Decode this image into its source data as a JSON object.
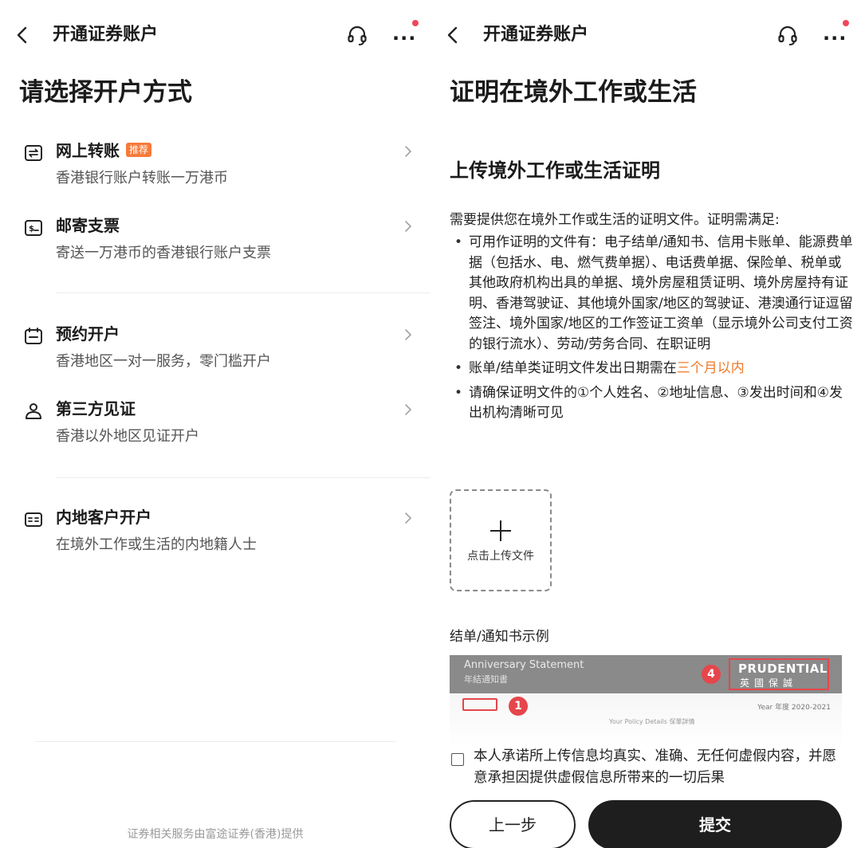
{
  "left": {
    "nav": {
      "title": "开通证券账户"
    },
    "heading": "请选择开户方式",
    "options": [
      {
        "title": "网上转账",
        "badge": "推荐",
        "desc": "香港银行账户转账一万港币"
      },
      {
        "title": "邮寄支票",
        "desc": "寄送一万港币的香港银行账户支票"
      },
      {
        "title": "预约开户",
        "desc": "香港地区一对一服务，零门槛开户"
      },
      {
        "title": "第三方见证",
        "desc": "香港以外地区见证开户"
      },
      {
        "title": "内地客户开户",
        "desc": "在境外工作或生活的内地籍人士"
      }
    ],
    "footer": "证券相关服务由富途证券(香港)提供"
  },
  "right": {
    "nav": {
      "title": "开通证券账户"
    },
    "heading": "证明在境外工作或生活",
    "subheading": "上传境外工作或生活证明",
    "intro": "需要提供您在境外工作或生活的证明文件。证明需满足:",
    "bullets": [
      "可用作证明的文件有：电子结单/通知书、信用卡账单、能源费单据（包括水、电、燃气费单据）、电话费单据、保险单、税单或其他政府机构出具的单据、境外房屋租赁证明、境外房屋持有证明、香港驾驶证、其他境外国家/地区的驾驶证、港澳通行证逗留签注、境外国家/地区的工作签证工资单（显示境外公司支付工资的银行流水）、劳动/劳务合同、在职证明",
      "请确保证明文件的①个人姓名、②地址信息、③发出时间和④发出机构清晰可见"
    ],
    "date_rule": {
      "prefix": "账单/结单类证明文件发出日期需在",
      "highlight": "三个月以内"
    },
    "upload_label": "点击上传文件",
    "sample_label": "结单/通知书示例",
    "sample": {
      "title_en": "Anniversary Statement",
      "title_zh": "年結通知書",
      "logo_en": "PRUDENTIAL",
      "logo_zh": "英國保誠",
      "year": "Year 年度 2020-2021",
      "policy": "Your Policy Details 保單詳情",
      "marker_1": "1",
      "marker_4": "4"
    },
    "agreement": "本人承诺所上传信息均真实、准确、无任何虚假内容，并愿意承担因提供虚假信息所带来的一切后果",
    "prev_label": "上一步",
    "submit_label": "提交"
  },
  "colors": {
    "accent": "#f07a2a",
    "badge": "#f57a3a",
    "marker": "#e5464c",
    "primary_button": "#1e1e1e"
  }
}
